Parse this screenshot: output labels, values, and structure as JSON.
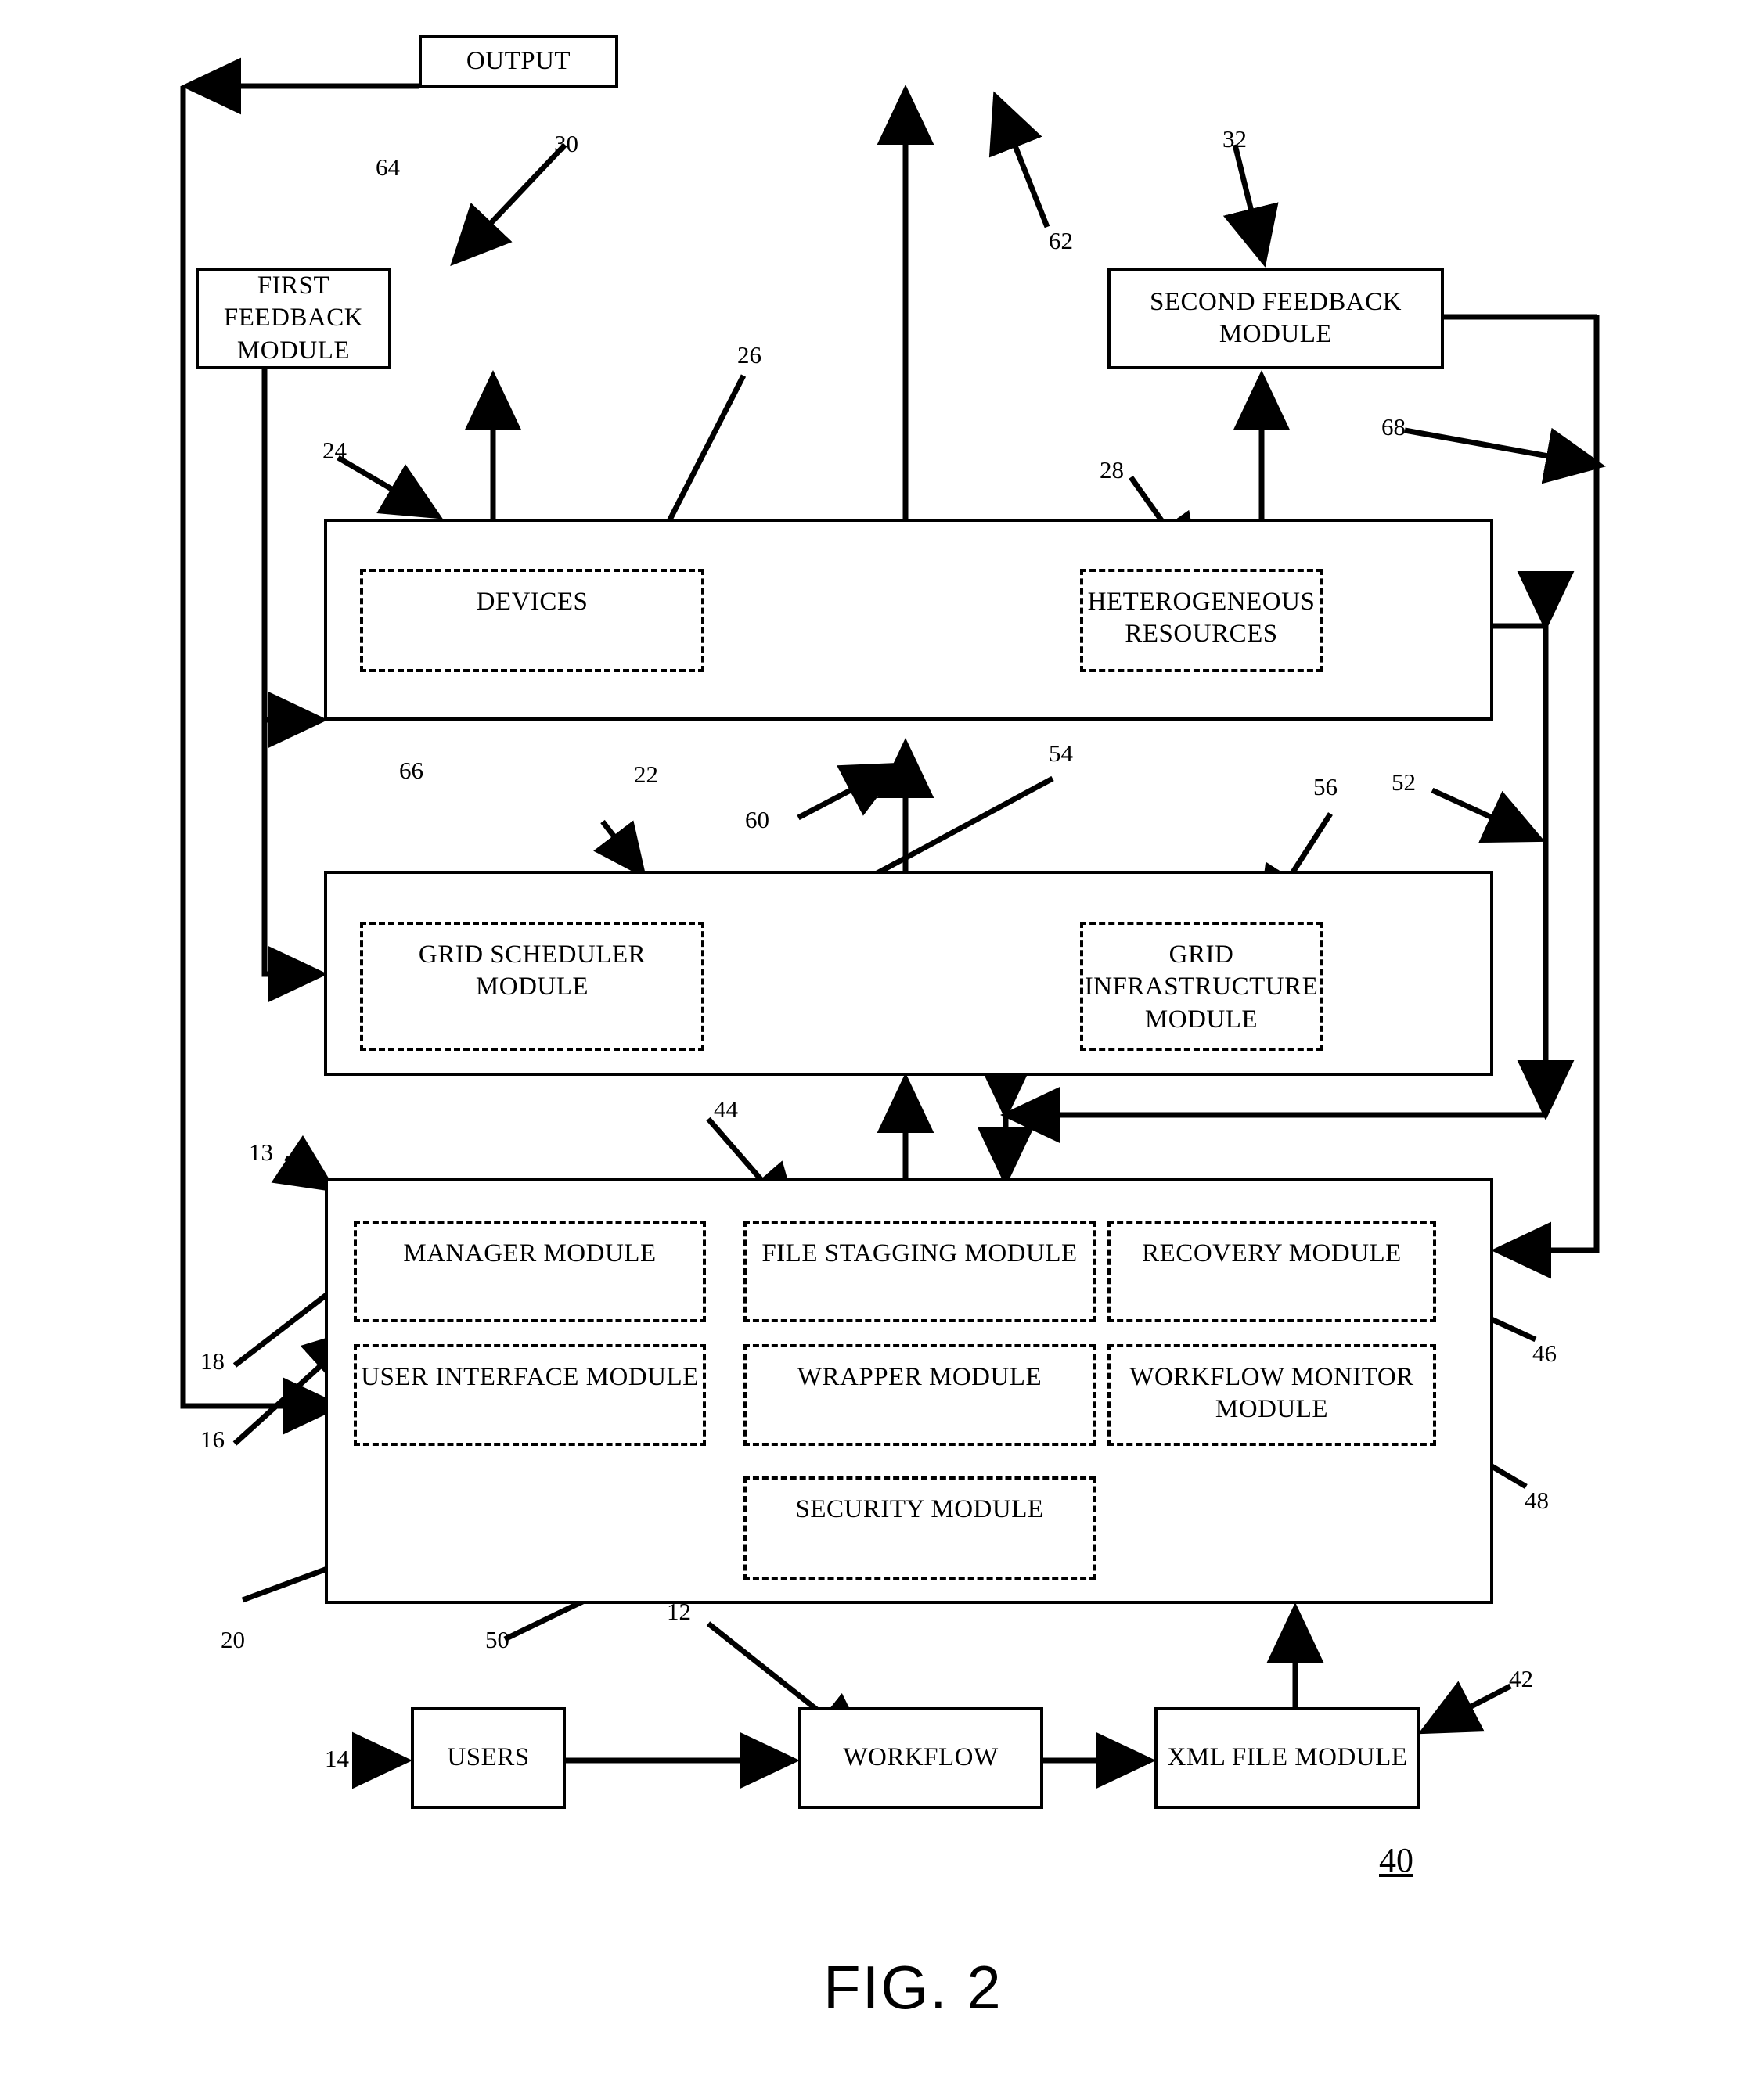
{
  "figure": {
    "caption": "FIG. 2",
    "system_numeral": "40"
  },
  "boxes": {
    "output": "OUTPUT",
    "first_feedback": "FIRST FEEDBACK MODULE",
    "second_feedback": "SECOND FEEDBACK MODULE",
    "devices": "DEVICES",
    "heterogeneous_resources": "HETEROGENEOUS RESOURCES",
    "grid_scheduler": "GRID SCHEDULER MODULE",
    "grid_infrastructure": "GRID INFRASTRUCTURE MODULE",
    "manager": "MANAGER MODULE",
    "file_stagging": "FILE STAGGING MODULE",
    "recovery": "RECOVERY MODULE",
    "user_interface": "USER INTERFACE MODULE",
    "wrapper": "WRAPPER MODULE",
    "workflow_monitor": "WORKFLOW MONITOR MODULE",
    "security": "SECURITY MODULE",
    "users": "USERS",
    "workflow": "WORKFLOW",
    "xml_file": "XML FILE MODULE"
  },
  "refs": {
    "n12": "12",
    "n13": "13",
    "n14": "14",
    "n16": "16",
    "n18": "18",
    "n20": "20",
    "n22": "22",
    "n24": "24",
    "n26": "26",
    "n28": "28",
    "n30": "30",
    "n32": "32",
    "n42": "42",
    "n44": "44",
    "n46": "46",
    "n48": "48",
    "n50": "50",
    "n52": "52",
    "n54": "54",
    "n56": "56",
    "n60": "60",
    "n62": "62",
    "n64": "64",
    "n66": "66",
    "n68": "68"
  }
}
